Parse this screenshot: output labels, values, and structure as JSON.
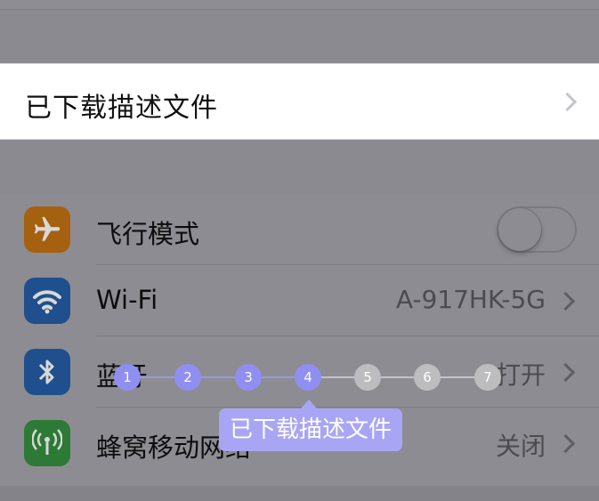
{
  "downloaded_profile": {
    "label": "已下载描述文件"
  },
  "settings": [
    {
      "key": "airplane",
      "title": "飞行模式",
      "icon": "airplane-icon",
      "icon_color": "#a5610f",
      "control": "toggle",
      "toggle_on": false
    },
    {
      "key": "wifi",
      "title": "Wi-Fi",
      "icon": "wifi-icon",
      "icon_color": "#1f4f8c",
      "value": "A-917HK-5G"
    },
    {
      "key": "bluetooth",
      "title": "蓝牙",
      "icon": "bluetooth-icon",
      "icon_color": "#1f4f8c",
      "value": "打开"
    },
    {
      "key": "cellular",
      "title": "蜂窝移动网络",
      "icon": "cellular-antenna-icon",
      "icon_color": "#2c7a35",
      "value": "关闭"
    }
  ],
  "tutorial": {
    "steps": [
      "1",
      "2",
      "3",
      "4",
      "5",
      "6",
      "7"
    ],
    "current_step": 4,
    "active_color": "#8f8ff2",
    "inactive_color": "#bdbdc0",
    "tooltip": "已下载描述文件"
  }
}
